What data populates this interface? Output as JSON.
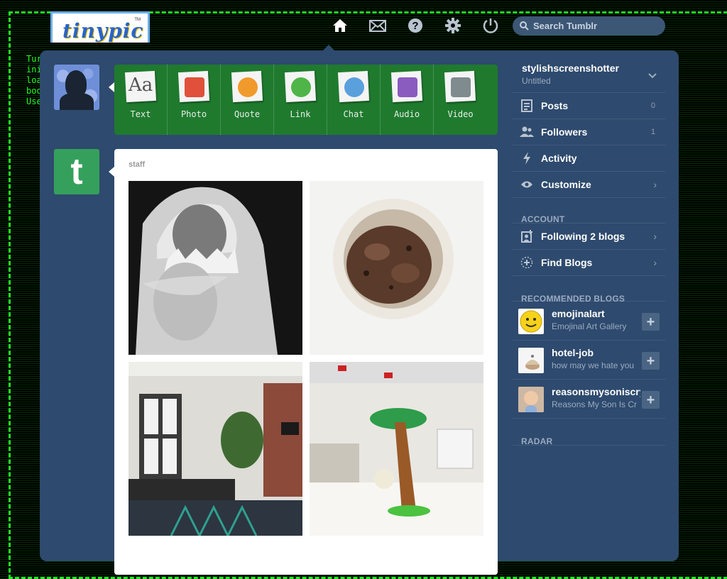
{
  "logo": {
    "text": "tinypic",
    "tm": "TM"
  },
  "terminal": {
    "lines": [
      "Tur",
      "ini",
      "loa",
      "boo",
      "Use"
    ]
  },
  "nav": {
    "icons": [
      "home-icon",
      "mail-icon",
      "help-icon",
      "gear-icon",
      "power-icon"
    ],
    "search_placeholder": "Search Tumblr"
  },
  "post_types": [
    {
      "label": "Text",
      "icon": "text-post-icon",
      "color": "#6b6b6b"
    },
    {
      "label": "Photo",
      "icon": "photo-post-icon",
      "color": "#e0503a"
    },
    {
      "label": "Quote",
      "icon": "quote-post-icon",
      "color": "#f19a2c"
    },
    {
      "label": "Link",
      "icon": "link-post-icon",
      "color": "#4fb548"
    },
    {
      "label": "Chat",
      "icon": "chat-post-icon",
      "color": "#5aa0dc"
    },
    {
      "label": "Audio",
      "icon": "audio-post-icon",
      "color": "#8a5cbf"
    },
    {
      "label": "Video",
      "icon": "video-post-icon",
      "color": "#7f8b8f"
    }
  ],
  "post": {
    "author": "staff",
    "avatar_letter": "t"
  },
  "sidebar": {
    "blog_name": "stylishscreenshotter",
    "blog_title": "Untitled",
    "items": [
      {
        "label": "Posts",
        "count": "0",
        "icon": "posts-icon"
      },
      {
        "label": "Followers",
        "count": "1",
        "icon": "followers-icon"
      },
      {
        "label": "Activity",
        "count": "",
        "icon": "activity-icon"
      },
      {
        "label": "Customize",
        "count": "",
        "icon": "eye-icon"
      }
    ],
    "account_header": "ACCOUNT",
    "account_items": [
      {
        "label": "Following 2 blogs",
        "icon": "following-icon"
      },
      {
        "label": "Find Blogs",
        "icon": "find-blogs-icon"
      }
    ],
    "recommended_header": "RECOMMENDED BLOGS",
    "recommended": [
      {
        "name": "emojinalart",
        "desc": "Emojinal Art Gallery"
      },
      {
        "name": "hotel-job",
        "desc": "how may we hate you"
      },
      {
        "name": "reasonsmysoniscrying",
        "desc": "Reasons My Son Is Crying"
      }
    ],
    "radar_header": "RADAR"
  }
}
